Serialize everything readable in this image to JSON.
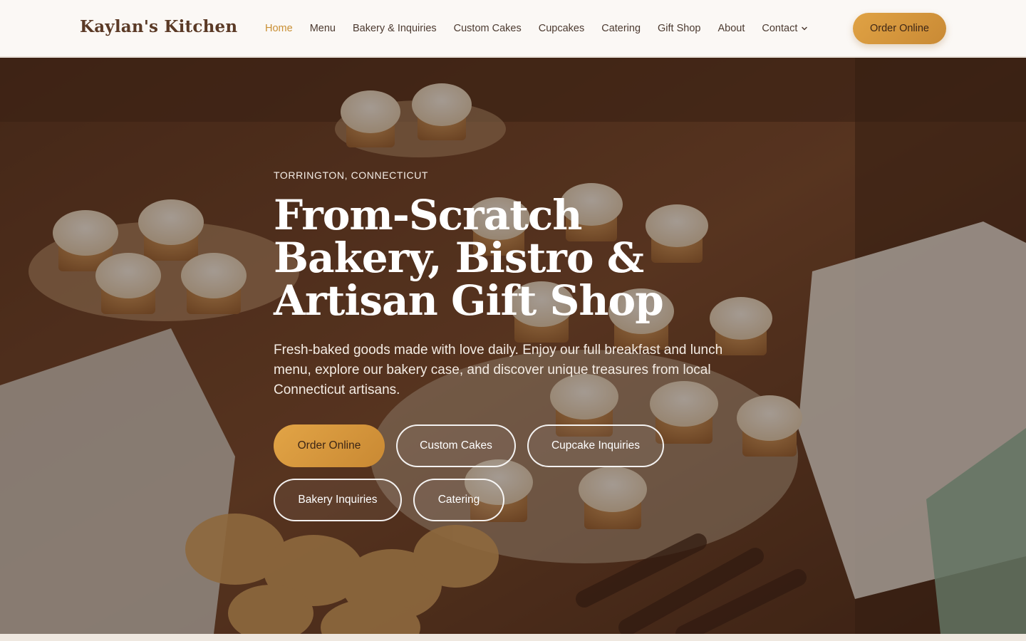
{
  "brand": {
    "name": "Kaylan's Kitchen"
  },
  "nav": {
    "items": [
      {
        "label": "Home",
        "active": true
      },
      {
        "label": "Menu"
      },
      {
        "label": "Bakery & Inquiries"
      },
      {
        "label": "Custom Cakes"
      },
      {
        "label": "Cupcakes"
      },
      {
        "label": "Catering"
      },
      {
        "label": "Gift Shop"
      },
      {
        "label": "About"
      }
    ],
    "contact": {
      "label": "Contact",
      "icon": "chevron-down-icon"
    },
    "cta": "Order Online"
  },
  "hero": {
    "eyebrow": "TORRINGTON, CONNECTICUT",
    "title": "From-Scratch Bakery, Bistro & Artisan Gift Shop",
    "description": "Fresh-baked goods made with love daily. Enjoy our full breakfast and lunch menu, explore our bakery case, and discover unique treasures from local Connecticut artisans.",
    "buttons": [
      {
        "label": "Order Online",
        "style": "primary"
      },
      {
        "label": "Custom Cakes",
        "style": "outline"
      },
      {
        "label": "Cupcake Inquiries",
        "style": "outline"
      },
      {
        "label": "Bakery Inquiries",
        "style": "outline"
      },
      {
        "label": "Catering",
        "style": "outline"
      }
    ]
  },
  "colors": {
    "accent": "#c98f34",
    "brand_text": "#5b3a26",
    "nav_bg": "#fbf8f5"
  }
}
